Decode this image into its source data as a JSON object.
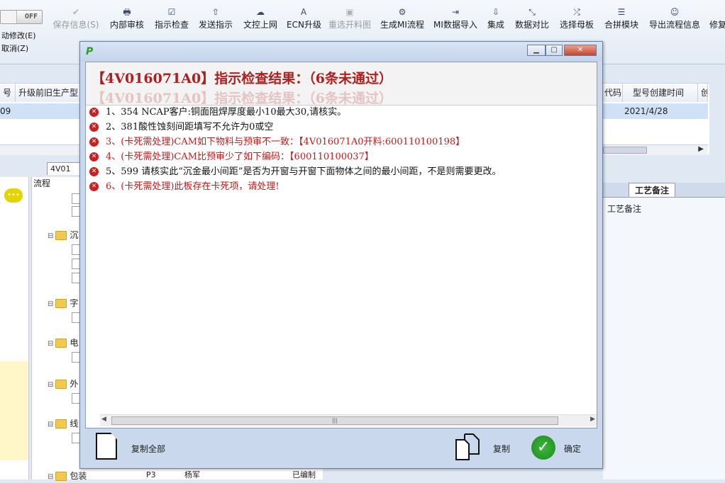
{
  "toolbar": {
    "off_label": "OFF",
    "side_menu": [
      "动修改(E)",
      "取消(Z)"
    ],
    "buttons": [
      {
        "label": "保存信息(S)",
        "icon": "check-icon",
        "glyph": "✔",
        "enabled": false
      },
      {
        "label": "内部审核",
        "icon": "printer-icon",
        "glyph": "🖶",
        "enabled": true
      },
      {
        "label": "指示检查",
        "icon": "checklist-icon",
        "glyph": "☑",
        "enabled": true
      },
      {
        "label": "发送指示",
        "icon": "upload-icon",
        "glyph": "⇧",
        "enabled": true
      },
      {
        "label": "文控上网",
        "icon": "cloud-upload-icon",
        "glyph": "☁",
        "enabled": true
      },
      {
        "label": "ECN升级",
        "icon": "letter-a-icon",
        "glyph": "A",
        "enabled": true
      },
      {
        "label": "重选开料图",
        "icon": "image-icon",
        "glyph": "▣",
        "enabled": false
      },
      {
        "label": "生成MI流程",
        "icon": "gears-icon",
        "glyph": "⚙",
        "enabled": true
      },
      {
        "label": "MI数据导入",
        "icon": "sign-in-icon",
        "glyph": "⇥",
        "enabled": true
      },
      {
        "label": "集成",
        "icon": "download-icon",
        "glyph": "⇩",
        "enabled": true
      },
      {
        "label": "数据对比",
        "icon": "compress-icon",
        "glyph": "⤡",
        "enabled": true
      },
      {
        "label": "选择母板",
        "icon": "shuffle-icon",
        "glyph": "⤮",
        "enabled": true
      },
      {
        "label": "合拼模块",
        "icon": "list-icon",
        "glyph": "☰",
        "enabled": true
      },
      {
        "label": "导出流程信息",
        "icon": "smile-icon",
        "glyph": "☺",
        "enabled": true
      },
      {
        "label": "修复",
        "icon": "wrench-icon",
        "glyph": "",
        "enabled": true
      }
    ]
  },
  "grid": {
    "headers": [
      "号",
      "升级前旧生产型",
      "代码",
      "型号创建时间",
      "创"
    ],
    "row": {
      "id_fragment": "09",
      "created": "2021/4/28"
    }
  },
  "lower": {
    "tab_label": "4V01",
    "tree_header": "流程",
    "tree_folders": [
      "沉",
      "字",
      "电",
      "外",
      "线",
      "包装"
    ],
    "bottom_row": {
      "col2": "P3",
      "col3": "杨军",
      "col4": "已编制"
    },
    "right_tab": "工艺备注",
    "right_label": "工艺备注"
  },
  "dialog": {
    "app_logo": "P",
    "title": "【4V016071A0】指示检查结果：（6条未通过）",
    "ghost_title": "【4V016071A0】指示检查结果：（6条未通过）",
    "messages": [
      {
        "text": "1、354 NCAP客户:铜面阻焊厚度最小10最大30,请核实。",
        "color": "black"
      },
      {
        "text": "2、381酸性蚀刻间距填写不允许为0或空",
        "color": "black"
      },
      {
        "text": "3、(卡死需处理)CAM如下物料与预审不一致：【4V016071A0开料:600110100198】",
        "color": "red"
      },
      {
        "text": "4、(卡死需处理)CAM比预审少了如下编码：【600110100037】",
        "color": "red"
      },
      {
        "text": "5、599 请核实此“沉金最小间距”是否为开窗与开窗下面物体之间的最小间距，不是则需要更改。",
        "color": "black"
      },
      {
        "text": "6、(卡死需处理)此板存在卡死项，请处理!",
        "color": "red"
      }
    ],
    "buttons": {
      "copy_all": "复制全部",
      "copy": "复制",
      "confirm": "确定"
    }
  }
}
